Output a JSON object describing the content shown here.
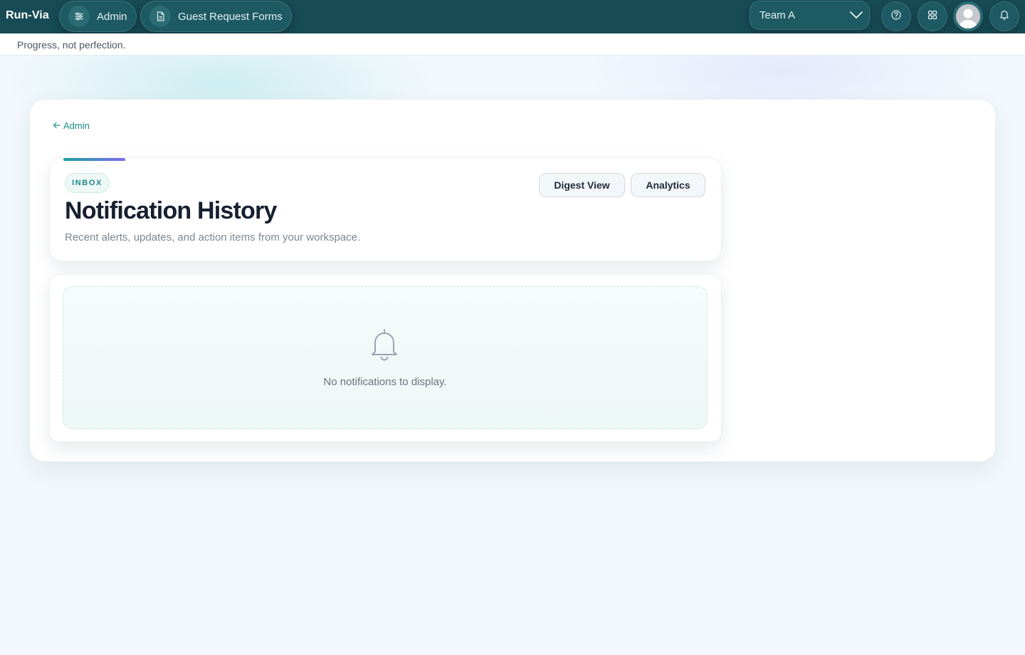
{
  "topbar": {
    "brand": "Run-Via",
    "nav": [
      {
        "label": "Admin",
        "icon": "sliders-icon"
      },
      {
        "label": "Guest Request Forms",
        "icon": "document-icon"
      }
    ],
    "team_select": {
      "value": "Team A",
      "icon": "chevron-down-icon"
    },
    "actions": [
      "help-icon",
      "apps-grid-icon",
      "avatar",
      "bell-icon"
    ]
  },
  "subbar": {
    "tagline": "Progress, not perfection."
  },
  "main": {
    "back_link": "Admin",
    "header": {
      "badge": "INBOX",
      "title": "Notification History",
      "subtitle": "Recent alerts, updates, and action items from your workspace.",
      "buttons": {
        "digest": "Digest View",
        "analytics": "Analytics"
      }
    },
    "empty_state": {
      "icon": "bell-icon",
      "message": "No notifications to display."
    }
  },
  "colors": {
    "topbar": "#174b55",
    "accent": "#1b8a8a",
    "accent_gradient_end": "#7c6bea",
    "page_bg": "#f2f8fd"
  }
}
